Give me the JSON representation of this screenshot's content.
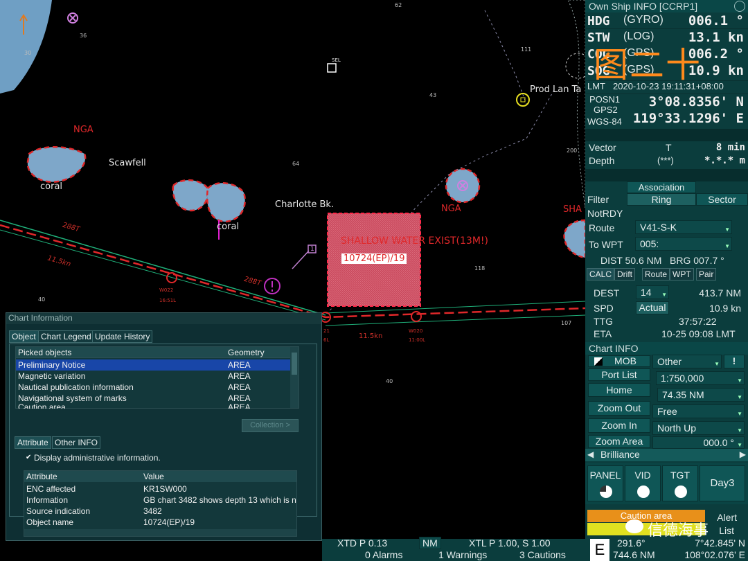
{
  "chart": {
    "depths": [
      {
        "v": "62"
      },
      {
        "v": "36"
      },
      {
        "v": "30"
      },
      {
        "v": "111"
      },
      {
        "v": "43"
      },
      {
        "v": "200"
      },
      {
        "v": "64"
      },
      {
        "v": "118"
      },
      {
        "v": "40"
      },
      {
        "v": "107"
      },
      {
        "v": "40"
      }
    ],
    "labels": {
      "scawfell": "Scawfell",
      "charlotte": "Charlotte Bk.",
      "coral1": "coral",
      "coral2": "coral",
      "nga1": "NGA",
      "nga2": "NGA",
      "sha": "SHA",
      "prod": "Prod Lan Ta",
      "sel": "SEL",
      "wpt1": "1"
    },
    "route": {
      "course": "288T",
      "course2": "288T",
      "speed": "11.5kn",
      "speed2": "11.5kn",
      "w022": "W022",
      "w022b": "16:51L",
      "w020": "W020",
      "w020b": "11:00L",
      "wa": "21",
      "wb": "6L"
    },
    "shallow": {
      "warning": "SHALLOW WATER EXIST(13M!)",
      "id": "10724(EP)/19"
    }
  },
  "own_ship": {
    "title": "Own Ship INFO [CCRP1]",
    "rows": [
      {
        "key": "HDG",
        "src": "(GYRO)",
        "val": "006.1 °"
      },
      {
        "key": "STW",
        "src": "(LOG)",
        "val": "13.1 kn"
      },
      {
        "key": "COG",
        "src": "(GPS)",
        "val": "006.2 °"
      },
      {
        "key": "SOG",
        "src": "(GPS)",
        "val": "10.9 kn"
      }
    ],
    "watermark": "图二十",
    "lmt_label": "LMT",
    "lmt": "2020-10-23 19:11:31+08:00",
    "posn1": "POSN1",
    "gps2": "GPS2",
    "wgs": "WGS-84",
    "lat": "3°08.8356' N",
    "lon": "119°33.1296' E",
    "vector_label": "Vector",
    "vector_mode": "T",
    "vector_val": "8 min",
    "depth_label": "Depth",
    "depth_mode": "(***)",
    "depth_val": "*.*.* m"
  },
  "assoc": {
    "label": "Association",
    "filter": "Filter",
    "ring": "Ring",
    "sector": "Sector",
    "notrdy": "NotRDY"
  },
  "route_info": {
    "route_label": "Route",
    "route_val": "V41-S-K",
    "towpt_label": "To WPT",
    "towpt_val": "005:",
    "dist": "DIST 50.6 NM",
    "brg": "BRG 007.7 °",
    "tabs": [
      "CALC",
      "Drift",
      "Route",
      "WPT",
      "Pair"
    ],
    "dest_label": "DEST",
    "dest_val": "14",
    "dest_nm": "413.7 NM",
    "spd_label": "SPD",
    "spd_mode": "Actual",
    "spd_val": "10.9 kn",
    "ttg_label": "TTG",
    "ttg_val": "37:57:22",
    "eta_label": "ETA",
    "eta_val": "10-25 09:08 LMT"
  },
  "chart_info": {
    "title": "Chart INFO",
    "mob": "MOB",
    "other": "Other",
    "excl": "!",
    "port_list": "Port List",
    "scale": "1:750,000",
    "home": "Home",
    "range": "74.35 NM",
    "zoom_out": "Zoom Out",
    "free": "Free",
    "zoom_in": "Zoom In",
    "north_up": "North Up",
    "zoom_area": "Zoom Area",
    "rot": "000.0 °",
    "brilliance": "Brilliance",
    "panel": "PANEL",
    "vid": "VID",
    "tgt": "TGT",
    "day": "Day3",
    "caution": "Caution area",
    "alert": "Alert",
    "list": "List",
    "wechat": "信德海事"
  },
  "status": {
    "xtd": "XTD P 0.13",
    "nm": "NM",
    "xtl": "XTL P 1.00, S 1.00",
    "alarms": "0 Alarms",
    "warnings": "1 Warnings",
    "cautions": "3 Cautions",
    "e": "E",
    "hdg": "291.6°",
    "dist": "744.6 NM",
    "lat": "7°42.845' N",
    "lon": "108°02.076' E"
  },
  "dialog": {
    "title": "Chart Information",
    "tabs": [
      "Object",
      "Chart Legend",
      "Update History"
    ],
    "picked_header": "Picked objects",
    "geom_header": "Geometry",
    "picked": [
      {
        "name": "Preliminary Notice",
        "geom": "AREA"
      },
      {
        "name": "Magnetic variation",
        "geom": "AREA"
      },
      {
        "name": "Nautical publication information",
        "geom": "AREA"
      },
      {
        "name": "Navigational system of marks",
        "geom": "AREA"
      },
      {
        "name": "Caution area",
        "geom": "AREA"
      }
    ],
    "collection": "Collection >",
    "tabs2": [
      "Attribute",
      "Other INFO"
    ],
    "display_admin": "Display administrative information.",
    "attr_header": "Attribute",
    "value_header": "Value",
    "attrs": [
      {
        "k": "ENC affected",
        "v": "KR1SW000"
      },
      {
        "k": "Information",
        "v": "GB chart 3482 shows depth 13 which is n"
      },
      {
        "k": "Source indication",
        "v": "3482"
      },
      {
        "k": "Object name",
        "v": "10724(EP)/19"
      }
    ]
  },
  "colors": {
    "bg": "#000000",
    "panel": "#0b3d3d",
    "accent": "#e0282a",
    "land": "#6f9fc4"
  }
}
